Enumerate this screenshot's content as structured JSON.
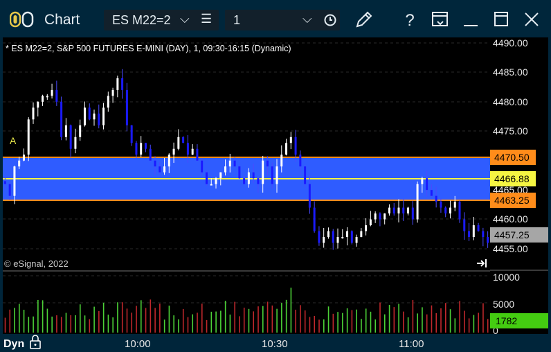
{
  "window": {
    "title": "Chart",
    "symbol": "ES M22=2",
    "interval": "1"
  },
  "chart": {
    "header": "* ES M22=2, S&P 500 FUTURES E-MINI (DAY), 1, 09:30-16:15 (Dynamic)",
    "copyright": "© eSignal, 2022",
    "marker_label": "A",
    "price_ticks": [
      "4490.00",
      "4485.00",
      "4480.00",
      "4475.00",
      "4465.00",
      "4460.00",
      "4455.00"
    ],
    "price_tags": {
      "upper": "4470.50",
      "mid": "4466.88",
      "lower": "4463.25",
      "last": "4457.25"
    },
    "volume_ticks": [
      "10000",
      "5000",
      "0"
    ],
    "volume_last": "1782",
    "time_ticks": [
      "10:00",
      "10:30",
      "11:00"
    ],
    "mode": "Dyn",
    "colors": {
      "band": "#2f5cff",
      "band_edge": "#ff8c1a",
      "mid_line": "#f5f542",
      "up_candle": "#ffffff",
      "down_candle": "#1a1aff",
      "vol_up": "#4cd137",
      "vol_down": "#c0282c"
    }
  },
  "toolbar": {
    "icons": [
      "pencil-icon",
      "help-icon",
      "window-list-icon",
      "minimize-icon",
      "maximize-icon",
      "close-icon"
    ]
  }
}
